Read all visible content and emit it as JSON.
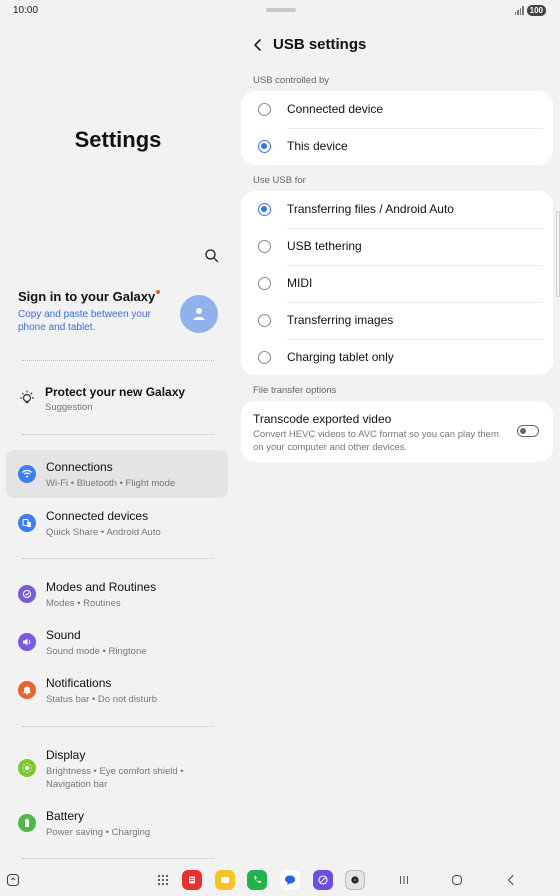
{
  "status_bar": {
    "time": "10:00",
    "battery": "100"
  },
  "left_panel": {
    "title": "Settings",
    "account": {
      "title": "Sign in to your Galaxy",
      "subtitle": "Copy and paste between your phone and tablet."
    },
    "suggestion": {
      "title": "Protect your new Galaxy",
      "subtitle": "Suggestion"
    },
    "menu": [
      {
        "title": "Connections",
        "subtitle": "Wi-Fi  •  Bluetooth  •  Flight mode",
        "icon": "wifi-icon",
        "color": "#3d7ef0",
        "active": true
      },
      {
        "title": "Connected devices",
        "subtitle": "Quick Share  •  Android Auto",
        "icon": "devices-icon",
        "color": "#3d7ef0"
      },
      {
        "title": "Modes and Routines",
        "subtitle": "Modes  •  Routines",
        "icon": "modes-icon",
        "color": "#7a5be0"
      },
      {
        "title": "Sound",
        "subtitle": "Sound mode  •  Ringtone",
        "icon": "sound-icon",
        "color": "#7a5be0"
      },
      {
        "title": "Notifications",
        "subtitle": "Status bar  •  Do not disturb",
        "icon": "bell-icon",
        "color": "#f0622b"
      },
      {
        "title": "Display",
        "subtitle": "Brightness  •  Eye comfort shield  •  Navigation bar",
        "icon": "sun-icon",
        "color": "#7dc82e"
      },
      {
        "title": "Battery",
        "subtitle": "Power saving  •  Charging",
        "icon": "battery-icon",
        "color": "#4fb84a"
      }
    ]
  },
  "right_panel": {
    "title": "USB settings",
    "controlled_by": {
      "label": "USB controlled by",
      "options": [
        {
          "label": "Connected device",
          "selected": false
        },
        {
          "label": "This device",
          "selected": true
        }
      ]
    },
    "use_usb_for": {
      "label": "Use USB for",
      "options": [
        {
          "label": "Transferring files / Android Auto",
          "selected": true
        },
        {
          "label": "USB tethering",
          "selected": false
        },
        {
          "label": "MIDI",
          "selected": false
        },
        {
          "label": "Transferring images",
          "selected": false
        },
        {
          "label": "Charging tablet only",
          "selected": false
        }
      ]
    },
    "file_transfer": {
      "label": "File transfer options",
      "transcode_title": "Transcode exported video",
      "transcode_sub": "Convert HEVC videos to AVC format so you can play them on your computer and other devices.",
      "transcode_on": false
    }
  },
  "taskbar": {
    "apps": [
      "app-drawer-icon",
      "flipboard-icon",
      "notes-icon",
      "phone-icon",
      "messages-icon",
      "internet-icon",
      "camera-icon"
    ],
    "nav": [
      "recents-icon",
      "home-icon",
      "back-icon"
    ]
  }
}
